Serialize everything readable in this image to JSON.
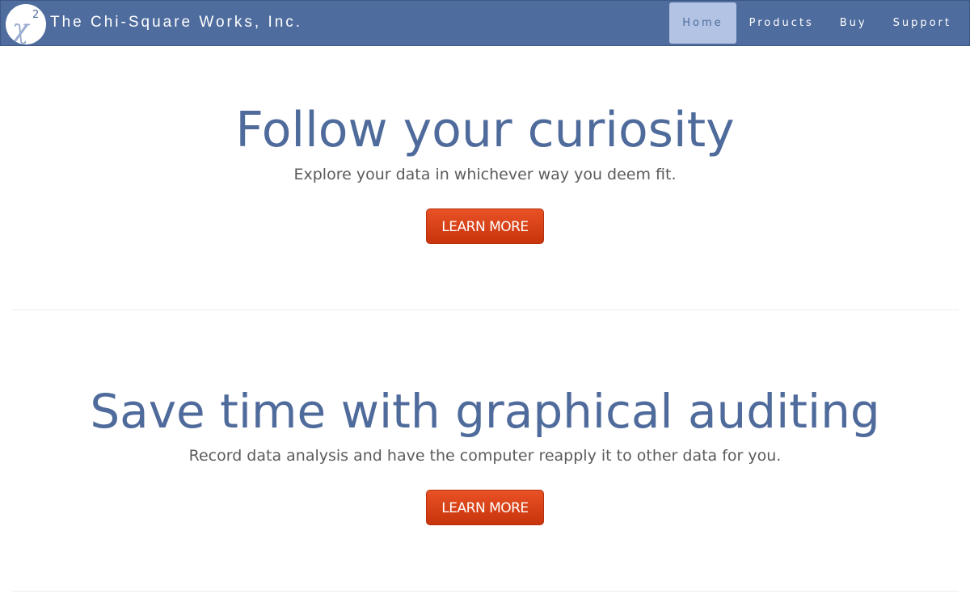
{
  "brand": {
    "name": "The Chi-Square Works, Inc.",
    "logo_symbol": "χ",
    "logo_superscript": "2"
  },
  "nav": {
    "items": [
      {
        "label": "Home",
        "active": true
      },
      {
        "label": "Products",
        "active": false
      },
      {
        "label": "Buy",
        "active": false
      },
      {
        "label": "Support",
        "active": false
      }
    ]
  },
  "sections": [
    {
      "title": "Follow your curiosity",
      "subtitle": "Explore your data in whichever way you deem fit.",
      "button": "LEARN MORE"
    },
    {
      "title": "Save time with graphical auditing",
      "subtitle": "Record data analysis and have the computer reapply it to other data for you.",
      "button": "LEARN MORE"
    }
  ],
  "colors": {
    "navbar": "#4f6c9e",
    "nav_active_bg": "#b2c3e3",
    "heading": "#4f6b9b",
    "cta": "#d9441a"
  }
}
